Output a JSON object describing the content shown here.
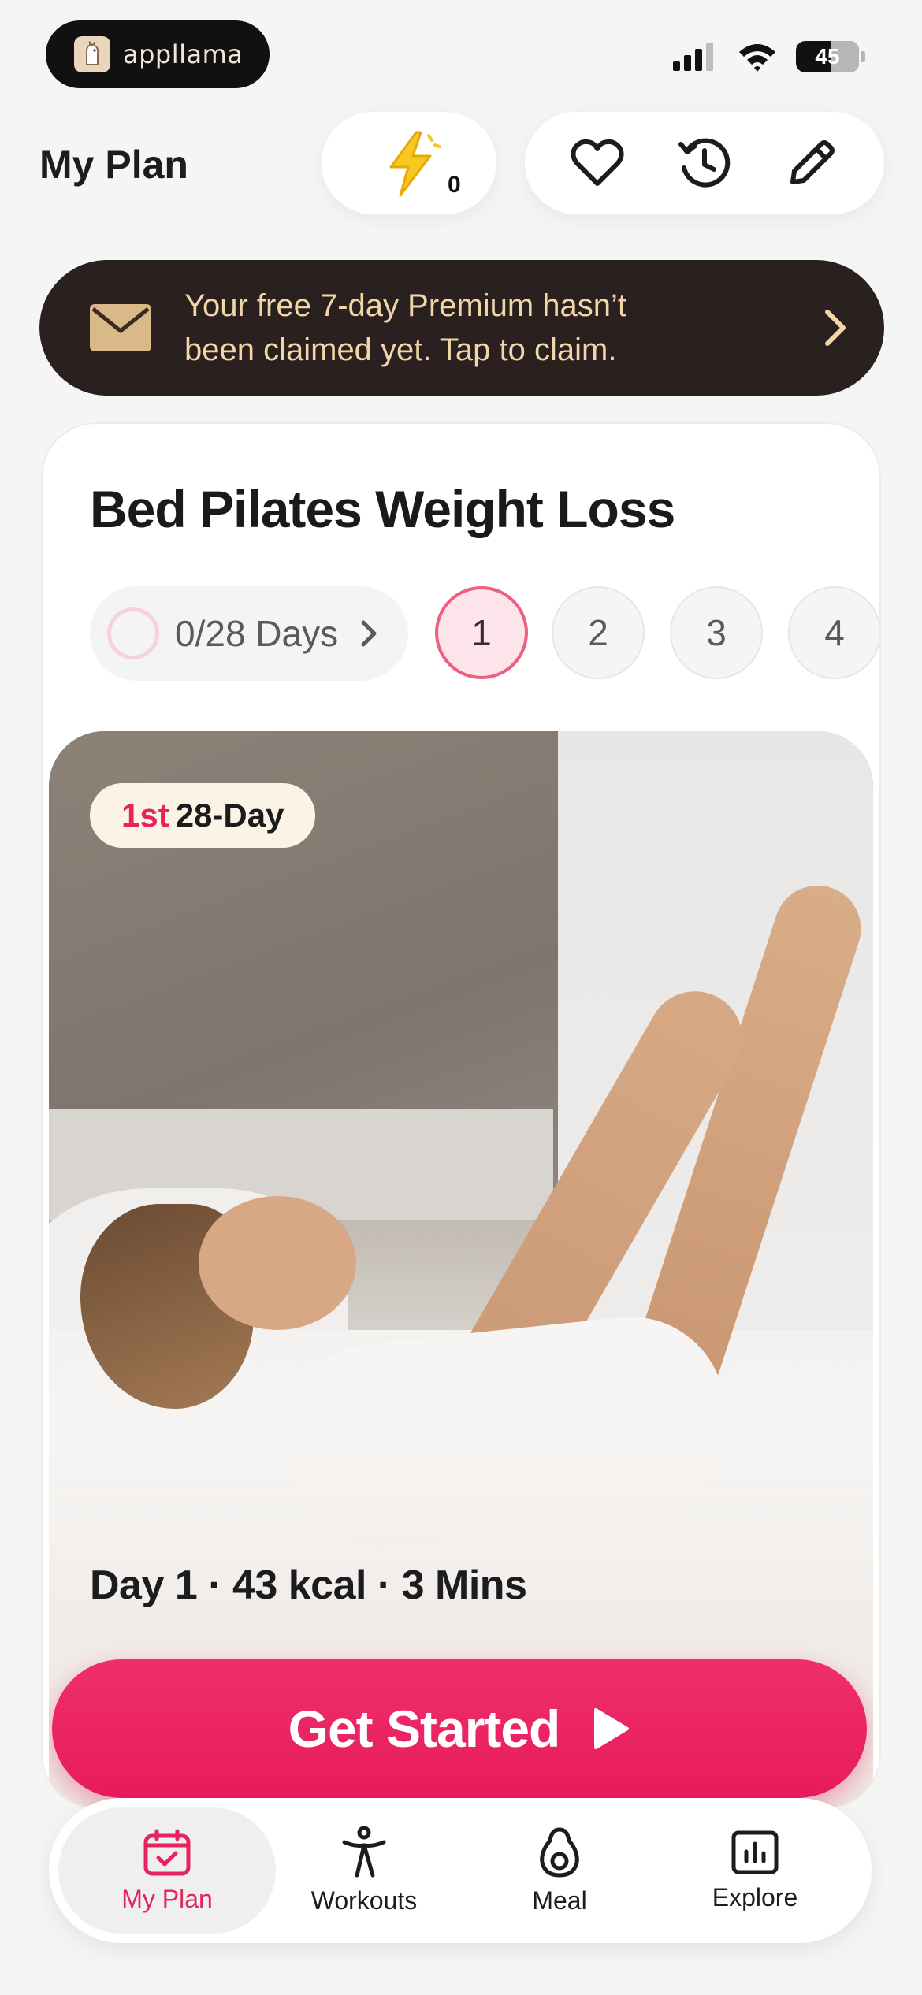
{
  "status_bar": {
    "brand": "appllama",
    "battery": "45"
  },
  "header": {
    "title": "My Plan",
    "energy_count": "0"
  },
  "banner": {
    "line1": "Your free 7-day Premium hasn’t",
    "line2": "been claimed yet. Tap to claim."
  },
  "plan": {
    "title": "Bed Pilates Weight Loss",
    "progress_label": "0/28 Days",
    "days": [
      "1",
      "2",
      "3",
      "4"
    ],
    "active_day": "1",
    "badge_ordinal": "1st",
    "badge_length": "28-Day",
    "day_info": "Day 1 · 43 kcal · 3 Mins",
    "cta_label": "Get Started"
  },
  "tabbar": {
    "tabs": [
      {
        "label": "My Plan",
        "icon": "calendar-check-icon",
        "active": true
      },
      {
        "label": "Workouts",
        "icon": "person-stretch-icon",
        "active": false
      },
      {
        "label": "Meal",
        "icon": "avocado-icon",
        "active": false
      },
      {
        "label": "Explore",
        "icon": "chart-box-icon",
        "active": false
      }
    ]
  },
  "colors": {
    "accent": "#e81b5b",
    "banner_bg": "#2a2020",
    "banner_text": "#f1d6a7",
    "active_day_bg": "#fde4ea"
  }
}
